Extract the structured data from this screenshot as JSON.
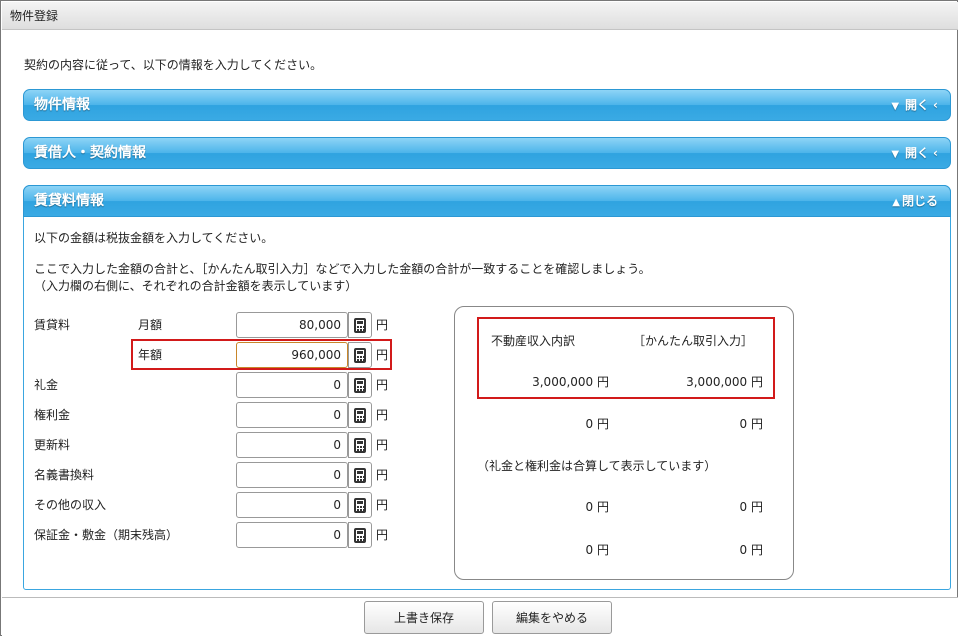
{
  "window": {
    "title": "物件登録"
  },
  "intro": "契約の内容に従って、以下の情報を入力してください。",
  "sections": {
    "property": {
      "title": "物件情報",
      "toggle": "開く"
    },
    "tenant": {
      "title": "賃借人・契約情報",
      "toggle": "開く"
    },
    "rent": {
      "title": "賃貸料情報",
      "toggle": "閉じる"
    }
  },
  "rent_panel": {
    "note1": "以下の金額は税抜金額を入力してください。",
    "note2": "ここで入力した金額の合計と、［かんたん取引入力］などで入力した金額の合計が一致することを確認しましょう。",
    "note3": "（入力欄の右側に、それぞれの合計金額を表示しています）",
    "currency": "円",
    "fields": {
      "rent_label": "賃貸料",
      "monthly_label": "月額",
      "monthly_value": "80,000",
      "annual_label": "年額",
      "annual_value": "960,000",
      "key_money_label": "礼金",
      "key_money_value": "0",
      "premium_label": "権利金",
      "premium_value": "0",
      "renewal_label": "更新料",
      "renewal_value": "0",
      "name_change_label": "名義書換料",
      "name_change_value": "0",
      "other_label": "その他の収入",
      "other_value": "0",
      "deposit_label": "保証金・敷金（期末残高）",
      "deposit_value": "0"
    }
  },
  "summary": {
    "header_left": "不動産収入内訳",
    "header_right": "［かんたん取引入力］",
    "rent_left": "3,000,000 円",
    "rent_right": "3,000,000 円",
    "key_left": "0 円",
    "key_right": "0 円",
    "note": "（礼金と権利金は合算して表示しています）",
    "renewal_left": "0 円",
    "renewal_right": "0 円",
    "name_change_left": "0 円",
    "name_change_right": "0 円"
  },
  "footer": {
    "save_label": "上書き保存",
    "cancel_label": "編集をやめる"
  },
  "colors": {
    "section_bar": "#3aaae4",
    "highlight": "#d21a1a"
  }
}
